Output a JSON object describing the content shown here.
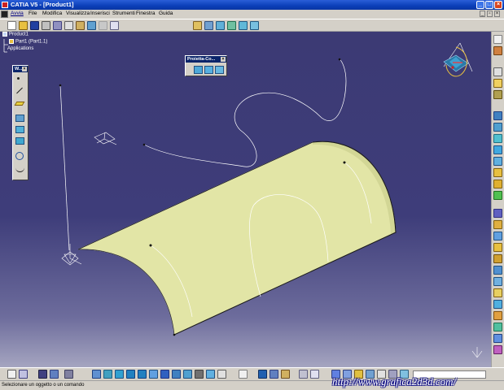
{
  "window": {
    "title": "CATIA V5 - [Product1]"
  },
  "menu": {
    "items": [
      "Avvia",
      "File",
      "Modifica",
      "Visualizza",
      "Inserisci",
      "Strumenti",
      "Finestra",
      "Guida"
    ],
    "active": "Avvia"
  },
  "tree": {
    "root": "Product1",
    "child": "Part1 (Part1.1)",
    "applications": "Applications"
  },
  "left_toolbar": {
    "title": "W..."
  },
  "project_toolbar": {
    "title": "Proietta-Co..."
  },
  "status": {
    "message": "Selezionare un oggetto o un comando"
  },
  "watermark": {
    "text": "http://www.grafica2d3d.com/"
  },
  "colors": {
    "title_bar": "#0b3fb8",
    "viewport_top": "#3c3a74",
    "viewport_bottom": "#a5a5c0",
    "surface": "#e2e5a6",
    "curve": "#ffffff"
  },
  "icons": {
    "top_toolbar": [
      "new-icon",
      "open-icon",
      "save-icon",
      "print-icon",
      "cut-icon",
      "copy-icon",
      "paste-icon",
      "undo-icon",
      "redo-icon",
      "whats-this-icon",
      "grid-icon",
      "sketch-icon",
      "swept-icon",
      "fill-icon",
      "blend-icon",
      "extrude-icon"
    ],
    "left_toolbar": [
      "point-icon",
      "line-icon",
      "plane-icon",
      "projection-icon",
      "intersection-icon",
      "circle-icon",
      "spline-icon",
      "helix-icon"
    ],
    "project_toolbar": [
      "project-icon",
      "combine-icon",
      "reflect-line-icon"
    ],
    "right_toolbar": [
      "select-icon",
      "sketcher-icon",
      "measure-icon",
      "extrude-surface-icon",
      "revolve-icon",
      "sphere-icon",
      "cylinder-icon",
      "offset-icon",
      "sweep-icon",
      "fill-surface-icon",
      "loft-icon",
      "blend-surface-icon",
      "join-icon",
      "heal-icon",
      "untrim-icon",
      "split-icon",
      "trim-icon",
      "boundary-icon",
      "extract-icon",
      "fillet-icon",
      "translate-icon",
      "rotate-icon",
      "symmetry-icon",
      "scaling-icon",
      "affinity-icon",
      "pattern-icon",
      "law-icon",
      "analysis-icon",
      "color-icon",
      "eraser-icon"
    ],
    "bottom_toolbar": [
      "formula-icon",
      "knowledge-icon",
      "table-icon",
      "catalog-icon",
      "fly-icon",
      "fit-all-icon",
      "pan-icon",
      "rotate-view-icon",
      "zoom-in-icon",
      "zoom-out-icon",
      "normal-view-icon",
      "iso-view-icon",
      "shading-icon",
      "hide-show-icon",
      "swap-visible-icon",
      "layer-icon",
      "measure-between-icon",
      "update-icon",
      "constraint-icon",
      "snap-icon",
      "grid-view-icon",
      "axis-icon",
      "paint-icon",
      "eraser-icon",
      "multi-view-icon",
      "sun-icon",
      "dress-icon",
      "wireframe-icon",
      "reflect-icon"
    ]
  }
}
